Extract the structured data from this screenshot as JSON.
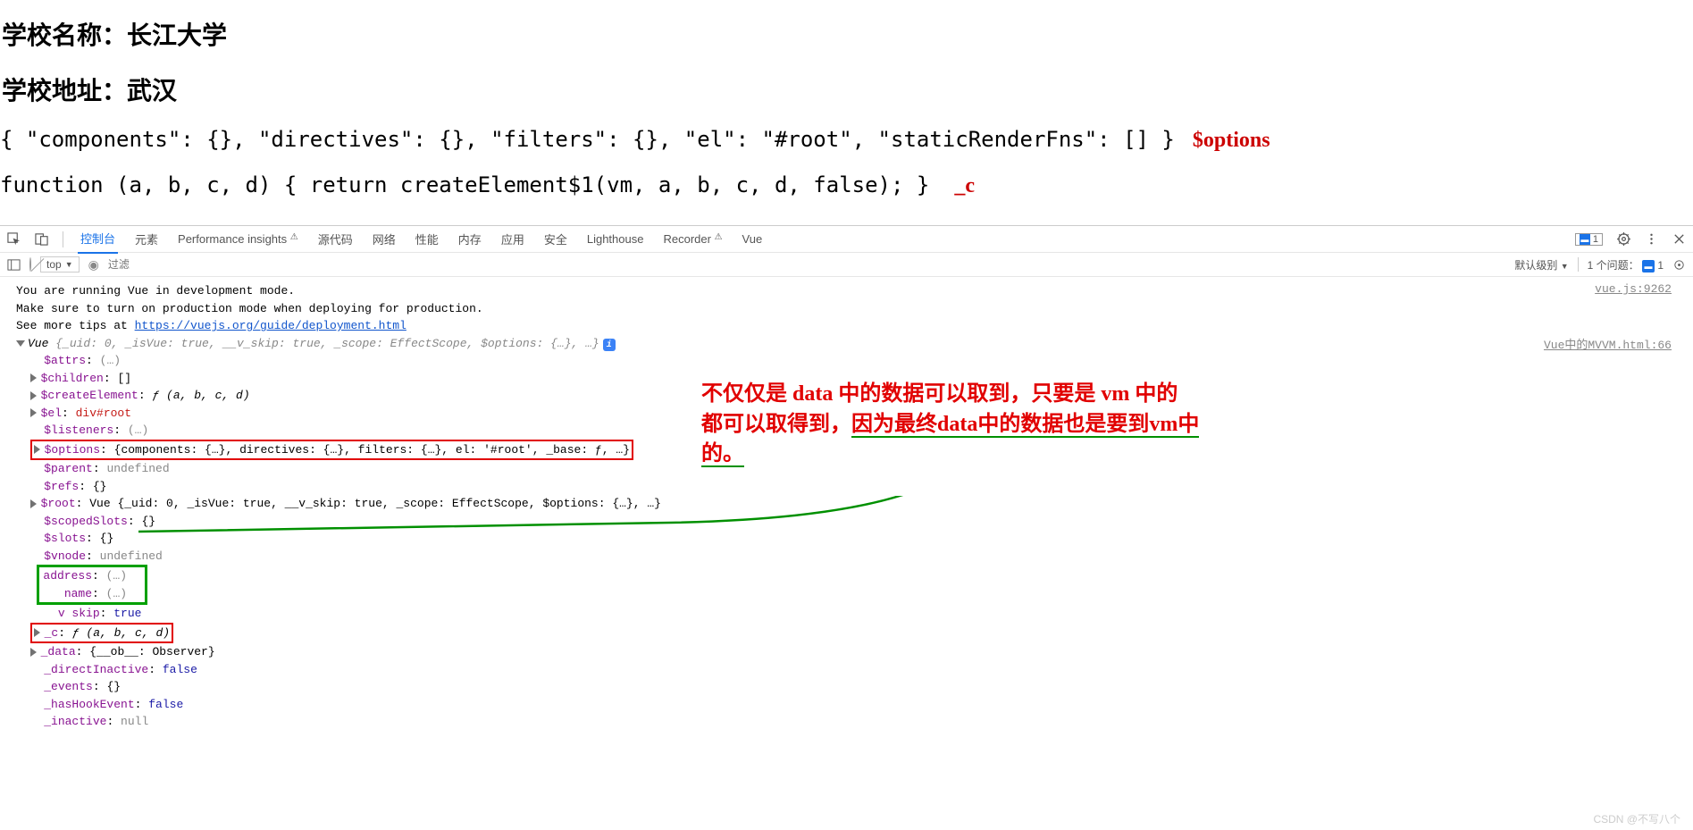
{
  "page": {
    "line1_label": "学校名称：",
    "line1_value": "长江大学",
    "line2_label": "学校地址：",
    "line2_value": "武汉",
    "obj_text": "{ \"components\": {}, \"directives\": {}, \"filters\": {}, \"el\": \"#root\", \"staticRenderFns\": [] }",
    "obj_ann": "$options",
    "fn_text": "function (a, b, c, d) { return createElement$1(vm, a, b, c, d, false); }",
    "fn_ann": "_c"
  },
  "devtools": {
    "tabs": {
      "console": "控制台",
      "elements": "元素",
      "perf": "Performance insights",
      "sources": "源代码",
      "network": "网络",
      "performance": "性能",
      "memory": "内存",
      "application": "应用",
      "security": "安全",
      "lighthouse": "Lighthouse",
      "recorder": "Recorder",
      "vue": "Vue"
    },
    "badge_count": "1",
    "filter": {
      "context": "top",
      "placeholder": "过滤",
      "level": "默认级别",
      "issues": "1 个问题：",
      "issue_count": "1"
    }
  },
  "console": {
    "src1": "vue.js:9262",
    "msg1": "You are running Vue in development mode.",
    "msg2": "Make sure to turn on production mode when deploying for production.",
    "msg3_a": "See more tips at ",
    "msg3_link": "https://vuejs.org/guide/deployment.html",
    "src2": "Vue中的MVVM.html:66",
    "vue_header_a": "Vue ",
    "vue_header_b": "{_uid: 0, _isVue: true, __v_skip: true, _scope: EffectScope, $options: {…}, …}",
    "p_attrs": "$attrs",
    "v_attrs": "(…)",
    "p_children": "$children",
    "v_children": "[]",
    "p_createEl": "$createElement",
    "v_createEl": "ƒ (a, b, c, d)",
    "p_el": "$el",
    "v_el": "div#root",
    "p_listeners": "$listeners",
    "v_listeners": "(…)",
    "p_options": "$options",
    "v_options": "{components: {…}, directives: {…}, filters: {…}, el: '#root', _base: ƒ, …}",
    "p_parent": "$parent",
    "v_parent": "undefined",
    "p_refs": "$refs",
    "v_refs": "{}",
    "p_root": "$root",
    "v_root": "Vue {_uid: 0, _isVue: true, __v_skip: true, _scope: EffectScope, $options: {…}, …}",
    "p_scopedSlots": "$scopedSlots",
    "v_scopedSlots": "{}",
    "p_slots": "$slots",
    "v_slots": "{}",
    "p_vnode": "$vnode",
    "v_vnode": "undefined",
    "p_address": "address",
    "v_address": "(…)",
    "p_name": "name",
    "v_name": "(…)",
    "p_vskip": "v skip",
    "v_vskip": "true",
    "p_c": "_c",
    "v_c": "ƒ (a, b, c, d)",
    "p_data": "_data",
    "v_data": "{__ob__: Observer}",
    "p_directInactive": "_directInactive",
    "v_directInactive": "false",
    "p_events": "_events",
    "v_events": "{}",
    "p_hasHookEvent": "_hasHookEvent",
    "v_hasHookEvent": "false",
    "p_inactive": "_inactive",
    "v_inactive": "null"
  },
  "annotation": {
    "l1": "不仅仅是 data 中的数据可以取到，只要是 vm 中的",
    "l2a": "都可以取得到，",
    "l2b": "因为最终data中的数据也是要到vm中",
    "l3": "的。"
  },
  "watermark": "CSDN @不写八个"
}
